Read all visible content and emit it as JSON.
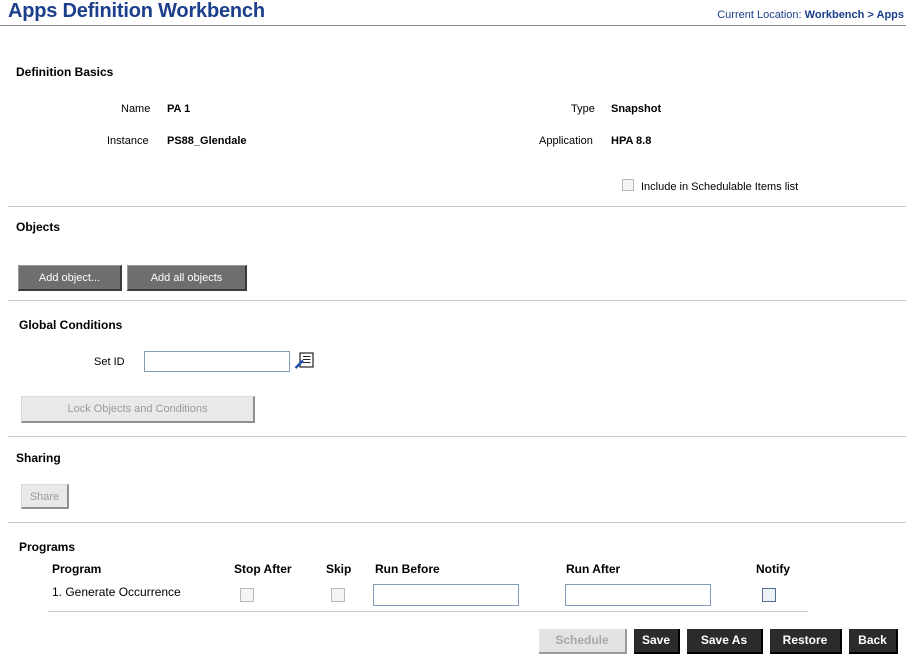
{
  "header": {
    "title": "Apps Definition Workbench",
    "location_prefix": "Current Location:",
    "location_path": "Workbench > Apps"
  },
  "basics": {
    "heading": "Definition Basics",
    "name_label": "Name",
    "name_value": "PA 1",
    "type_label": "Type",
    "type_value": "Snapshot",
    "instance_label": "Instance",
    "instance_value": "PS88_Glendale",
    "application_label": "Application",
    "application_value": "HPA 8.8",
    "schedulable_label": "Include in Schedulable Items list"
  },
  "objects": {
    "heading": "Objects",
    "add_object": "Add object...",
    "add_all": "Add all objects"
  },
  "conditions": {
    "heading": "Global Conditions",
    "setid_label": "Set ID",
    "setid_value": "",
    "lock_button": "Lock Objects and Conditions"
  },
  "sharing": {
    "heading": "Sharing",
    "share_button": "Share"
  },
  "programs": {
    "heading": "Programs",
    "columns": [
      "Program",
      "Stop After",
      "Skip",
      "Run Before",
      "Run After",
      "Notify"
    ],
    "rows": [
      {
        "program": "1.  Generate Occurrence",
        "run_before": "",
        "run_after": ""
      }
    ]
  },
  "footer": {
    "schedule": "Schedule",
    "save": "Save",
    "save_as": "Save As",
    "restore": "Restore",
    "back": "Back"
  },
  "icons": {
    "lookup": "lookup-icon"
  }
}
